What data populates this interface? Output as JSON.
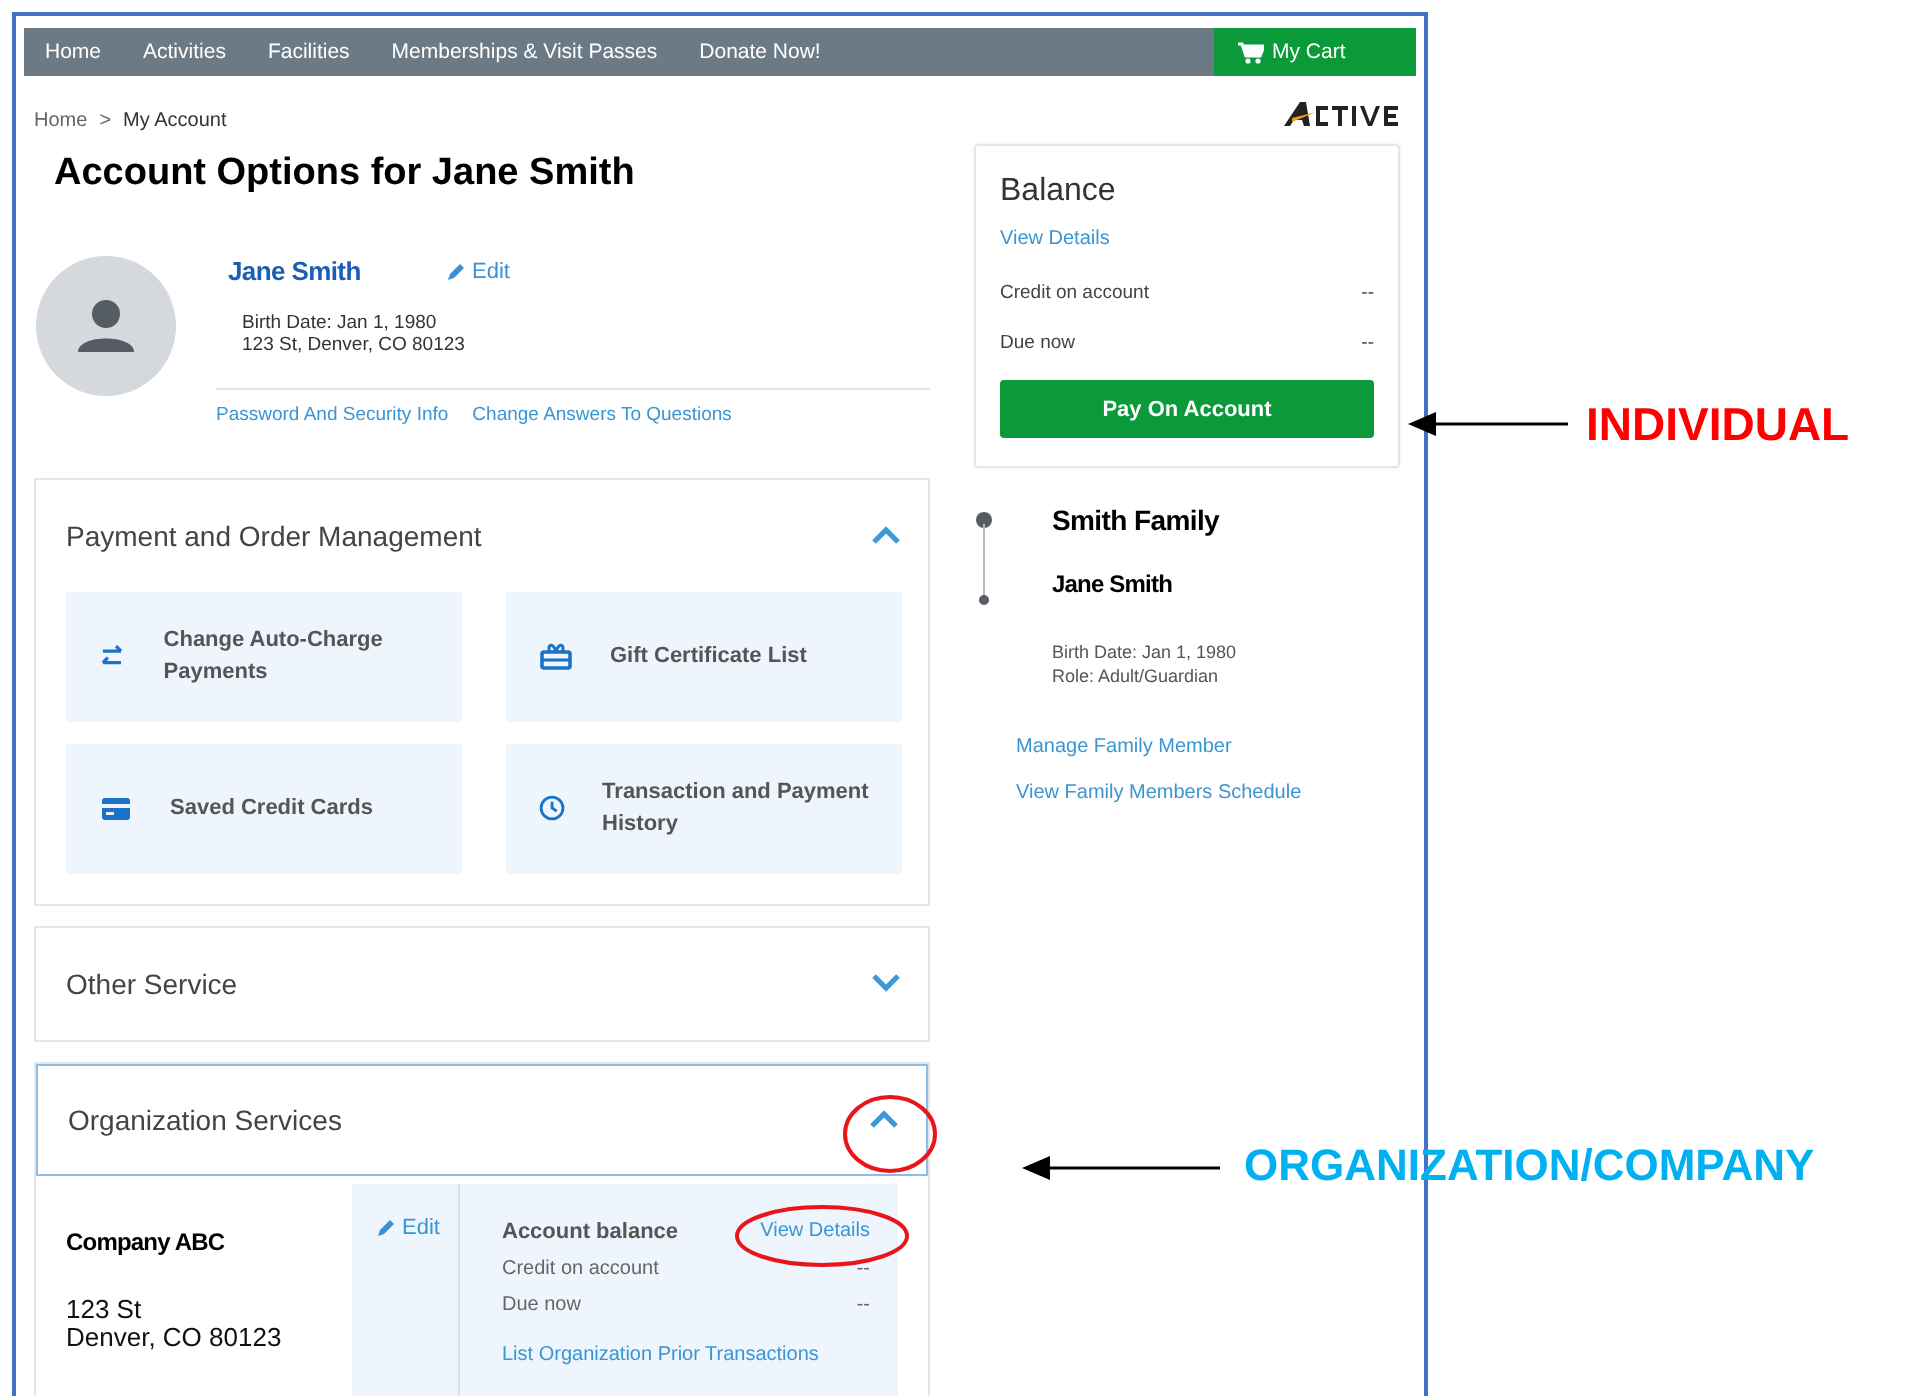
{
  "nav": {
    "items": [
      "Home",
      "Activities",
      "Facilities",
      "Memberships & Visit Passes",
      "Donate Now!"
    ],
    "cart": "My Cart"
  },
  "breadcrumb": [
    "Home",
    ">",
    "My Account"
  ],
  "title": "Account Options for Jane Smith",
  "profile": {
    "name": "Jane Smith",
    "edit": "Edit",
    "birth_date": "Birth Date: Jan 1, 1980",
    "address": "123 St, Denver, CO 80123",
    "links": [
      "Password And Security Info",
      "Change Answers To Questions"
    ]
  },
  "sections": [
    {
      "title": "Payment and Order Management",
      "expanded": true,
      "focused": false,
      "tiles": [
        "Change Auto-Charge Payments",
        "Gift Certificate List",
        "Saved Credit Cards",
        "Transaction and Payment History"
      ]
    },
    {
      "title": "Other Service",
      "expanded": false,
      "focused": false
    },
    {
      "title": "Organization Services",
      "expanded": true,
      "focused": true,
      "organization": {
        "name": "Company ABC",
        "address_line_1": "123 St",
        "address_line_2": "Denver, CO 80123",
        "edit": "Edit",
        "balance_title": "Account balance",
        "view_details": "View Details",
        "rows": [
          {
            "label": "Credit on account",
            "value": "--"
          },
          {
            "label": "Due now",
            "value": "--"
          }
        ],
        "link": "List Organization Prior Transactions"
      }
    }
  ],
  "balance": {
    "title": "Balance",
    "view_details": "View Details",
    "rows": [
      {
        "label": "Credit on account",
        "value": "--"
      },
      {
        "label": "Due now",
        "value": "--"
      }
    ],
    "button": "Pay On Account"
  },
  "family": {
    "name": "Smith Family",
    "member": {
      "name": "Jane Smith",
      "birth_date": "Birth Date: Jan 1, 1980",
      "role": "Role: Adult/Guardian"
    },
    "links": [
      "Manage Family Member",
      "View Family Members Schedule"
    ]
  },
  "annotations": [
    {
      "text": "INDIVIDUAL",
      "color": "#ff0000"
    },
    {
      "text": "ORGANIZATION/COMPANY",
      "color": "#00b0f0"
    }
  ]
}
